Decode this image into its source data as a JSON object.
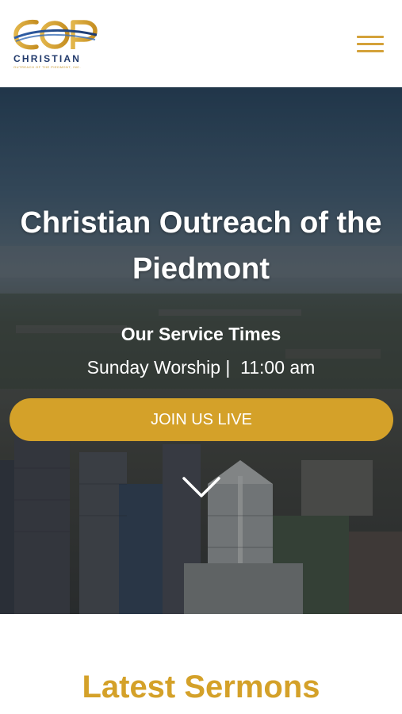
{
  "header": {
    "logo_text": "COP",
    "logo_word": "CHRISTIAN",
    "logo_tagline": "OUTREACH OF THE PIEDMONT, INC.",
    "menu_icon": "hamburger-menu-icon",
    "accent_color": "#d4a23a",
    "navy_color": "#223a6b"
  },
  "hero": {
    "title": "Christian Outreach of the Piedmont",
    "service_heading": "Our Service Times",
    "service_times": "Sunday Worship |  11:00 am",
    "cta_label": "JOIN US LIVE",
    "cta_color": "#d4a129",
    "scroll_icon": "chevron-down-icon"
  },
  "sections": {
    "sermons_title": "Latest Sermons"
  }
}
